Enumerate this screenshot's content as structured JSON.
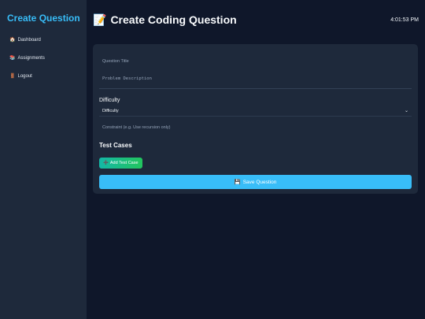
{
  "sidebar": {
    "brand": "Create Question",
    "items": [
      {
        "icon": "🏠",
        "label": "Dashboard"
      },
      {
        "icon": "📚",
        "label": "Assignments"
      },
      {
        "icon": "🚪",
        "label": "Logout"
      }
    ]
  },
  "header": {
    "icon": "📝",
    "title": "Create Coding Question",
    "clock": "4:01:53 PM"
  },
  "form": {
    "title_placeholder": "Question Title",
    "description_placeholder": "Problem Description",
    "difficulty_label": "Difficulty",
    "difficulty_value": "Difficulty",
    "difficulty_chevron": "⌄",
    "constraint_placeholder": "Constraint (e.g. Use recursion only)",
    "test_cases_title": "Test Cases",
    "add_test_case_icon": "➕",
    "add_test_case_label": "Add Test Case",
    "save_icon": "💾",
    "save_label": "Save Question"
  },
  "colors": {
    "accent": "#38bdf8",
    "sidebar_bg": "#1e293b",
    "page_bg": "#0f172a",
    "add_button": "#10b981"
  }
}
